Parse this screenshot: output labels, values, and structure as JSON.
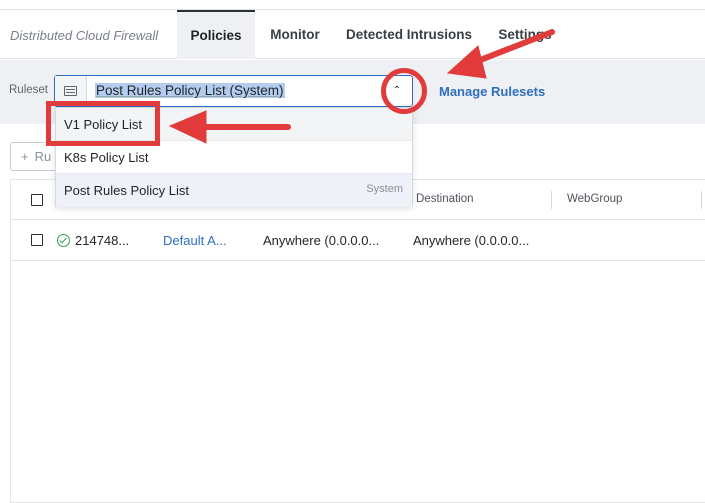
{
  "app": {
    "name": "Distributed Cloud Firewall"
  },
  "tabs": [
    {
      "label": "Policies",
      "active": true
    },
    {
      "label": "Monitor",
      "active": false
    },
    {
      "label": "Detected Intrusions",
      "active": false
    },
    {
      "label": "Settings",
      "active": false
    }
  ],
  "ruleset": {
    "label": "Ruleset",
    "selected": "Post Rules Policy List (System)",
    "manage_label": "Manage Rulesets",
    "options": [
      {
        "label": "V1 Policy List",
        "tag": ""
      },
      {
        "label": "K8s Policy List",
        "tag": ""
      },
      {
        "label": "Post Rules Policy List",
        "tag": "System"
      }
    ]
  },
  "toolbar": {
    "add_label": "Ru"
  },
  "table": {
    "columns": [
      "Destination",
      "WebGroup"
    ],
    "rows": [
      {
        "id": "214748...",
        "name": "Default A...",
        "source": "Anywhere (0.0.0.0...",
        "destination": "Anywhere (0.0.0.0..."
      }
    ]
  },
  "colors": {
    "accent": "#2f6fbf",
    "annotation": "#e23b3b",
    "status_ok": "#2e9e4f"
  }
}
